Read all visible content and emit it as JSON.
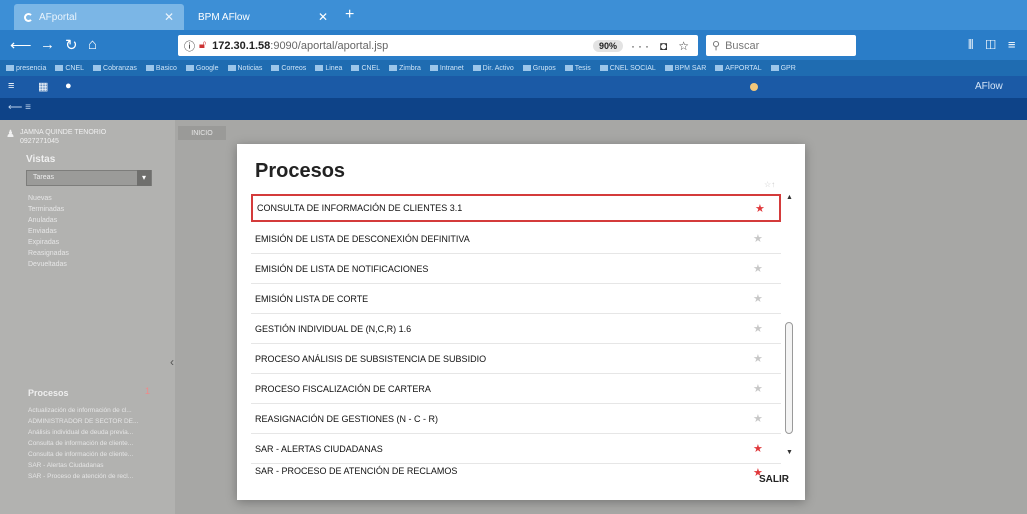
{
  "browser": {
    "tabs": [
      {
        "label": "AFportal",
        "active": true
      },
      {
        "label": "BPM AFlow",
        "active": false
      }
    ],
    "url_host": "172.30.1.58",
    "url_path": ":9090/aportal/aportal.jsp",
    "zoom": "90%",
    "search_placeholder": "Buscar",
    "bookmarks": [
      "presencia",
      "CNEL",
      "Cobranzas",
      "Basico",
      "Google",
      "Noticias",
      "Correos",
      "Linea",
      "CNEL",
      "Zimbra",
      "Intranet",
      "Dir. Activo",
      "Grupos",
      "Tesis",
      "CNEL SOCIAL",
      "BPM SAR",
      "AFPORTAL",
      "GPR"
    ]
  },
  "app": {
    "brand": "AFlow",
    "inicio_tab": "INICIO",
    "user_name": "JAMNA QUINDE TENORIO",
    "user_id": "0927271045",
    "vistas_title": "Vistas",
    "vistas_select": "Tareas",
    "vistas_items": [
      "Nuevas",
      "Terminadas",
      "Anuladas",
      "Enviadas",
      "Expiradas",
      "Reasignadas",
      "Devueltadas"
    ],
    "procesos_title": "Procesos",
    "procesos_count": "1",
    "procesos_items": [
      "Actualización de información de cl...",
      "ADMINISTRADOR DE SECTOR DE...",
      "Análisis individual de deuda previa...",
      "Consulta de información de cliente...",
      "Consulta de información de cliente...",
      "SAR - Alertas Ciudadanas",
      "SAR - Proceso de atención de recl..."
    ]
  },
  "modal": {
    "title": "Procesos",
    "items": [
      {
        "label": "CONSULTA DE INFORMACIÓN DE CLIENTES 3.1",
        "favorite": true
      },
      {
        "label": "EMISIÓN DE LISTA DE DESCONEXIÓN DEFINITIVA",
        "favorite": false
      },
      {
        "label": "EMISIÓN DE LISTA DE NOTIFICACIONES",
        "favorite": false
      },
      {
        "label": "EMISIÓN LISTA DE CORTE",
        "favorite": false
      },
      {
        "label": "GESTIÓN INDIVIDUAL DE (N,C,R) 1.6",
        "favorite": false
      },
      {
        "label": "PROCESO ANÁLISIS DE SUBSISTENCIA DE SUBSIDIO",
        "favorite": false
      },
      {
        "label": "PROCESO FISCALIZACIÓN DE CARTERA",
        "favorite": false
      },
      {
        "label": "REASIGNACIÓN DE GESTIONES (N - C - R)",
        "favorite": false
      },
      {
        "label": "SAR - ALERTAS CIUDADANAS",
        "favorite": true
      },
      {
        "label": "SAR - PROCESO DE ATENCIÓN DE RECLAMOS",
        "favorite": true
      }
    ],
    "salir_label": "SALIR"
  },
  "colors": {
    "accent": "#2a7dc8",
    "favorite_star": "#e0383b",
    "highlight_border": "#d43b3b"
  }
}
